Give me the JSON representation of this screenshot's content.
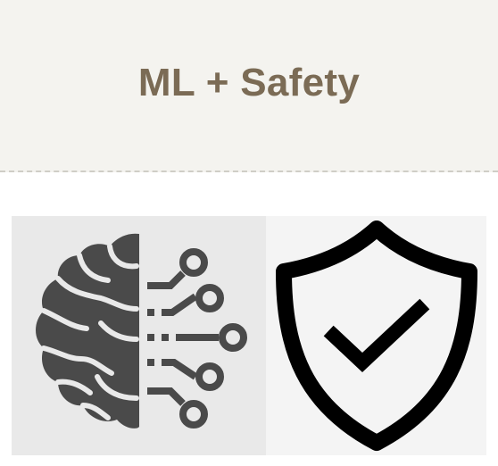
{
  "header": {
    "title": "ML + Safety",
    "background": "#f4f3ef",
    "title_color": "#7b6b55"
  },
  "images": [
    {
      "icon": "brain-circuit-icon"
    },
    {
      "icon": "shield-check-icon"
    }
  ]
}
